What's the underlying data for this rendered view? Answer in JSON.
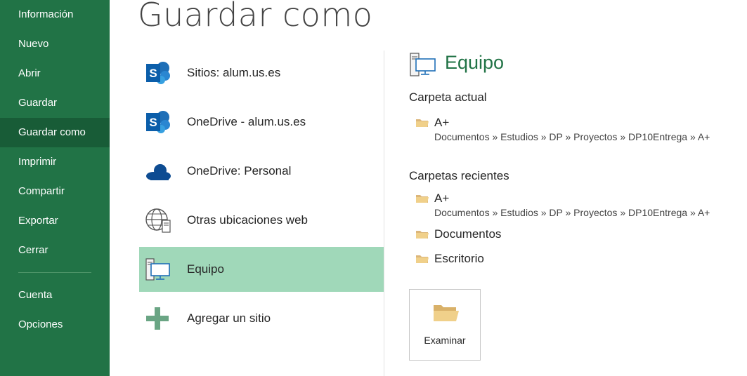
{
  "sidebar": {
    "items": [
      {
        "label": "Información"
      },
      {
        "label": "Nuevo"
      },
      {
        "label": "Abrir"
      },
      {
        "label": "Guardar"
      },
      {
        "label": "Guardar como"
      },
      {
        "label": "Imprimir"
      },
      {
        "label": "Compartir"
      },
      {
        "label": "Exportar"
      },
      {
        "label": "Cerrar"
      },
      {
        "label": "Cuenta"
      },
      {
        "label": "Opciones"
      }
    ],
    "active": "Guardar como"
  },
  "page": {
    "title": "Guardar como"
  },
  "places": [
    {
      "label": "Sitios: alum.us.es",
      "icon": "sharepoint-icon"
    },
    {
      "label": "OneDrive - alum.us.es",
      "icon": "sharepoint-icon"
    },
    {
      "label": "OneDrive: Personal",
      "icon": "onedrive-cloud-icon"
    },
    {
      "label": "Otras ubicaciones web",
      "icon": "web-globe-icon"
    },
    {
      "label": "Equipo",
      "icon": "computer-icon",
      "selected": true
    },
    {
      "label": "Agregar un sitio",
      "icon": "plus-icon"
    }
  ],
  "right_panel": {
    "title": "Equipo",
    "current_folder": {
      "heading": "Carpeta actual",
      "name": "A+",
      "path": "Documentos » Estudios » DP » Proyectos » DP10Entrega » A+"
    },
    "recent": {
      "heading": "Carpetas recientes",
      "folders": [
        {
          "name": "A+",
          "path": "Documentos » Estudios » DP » Proyectos » DP10Entrega » A+"
        },
        {
          "name": "Documentos"
        },
        {
          "name": "Escritorio"
        }
      ]
    },
    "browse_label": "Examinar"
  },
  "colors": {
    "sidebar_bg": "#217346",
    "sidebar_active": "#185c37",
    "selected_place": "#a0d8b9",
    "accent_title": "#217346",
    "folder": "#dcb67a"
  }
}
